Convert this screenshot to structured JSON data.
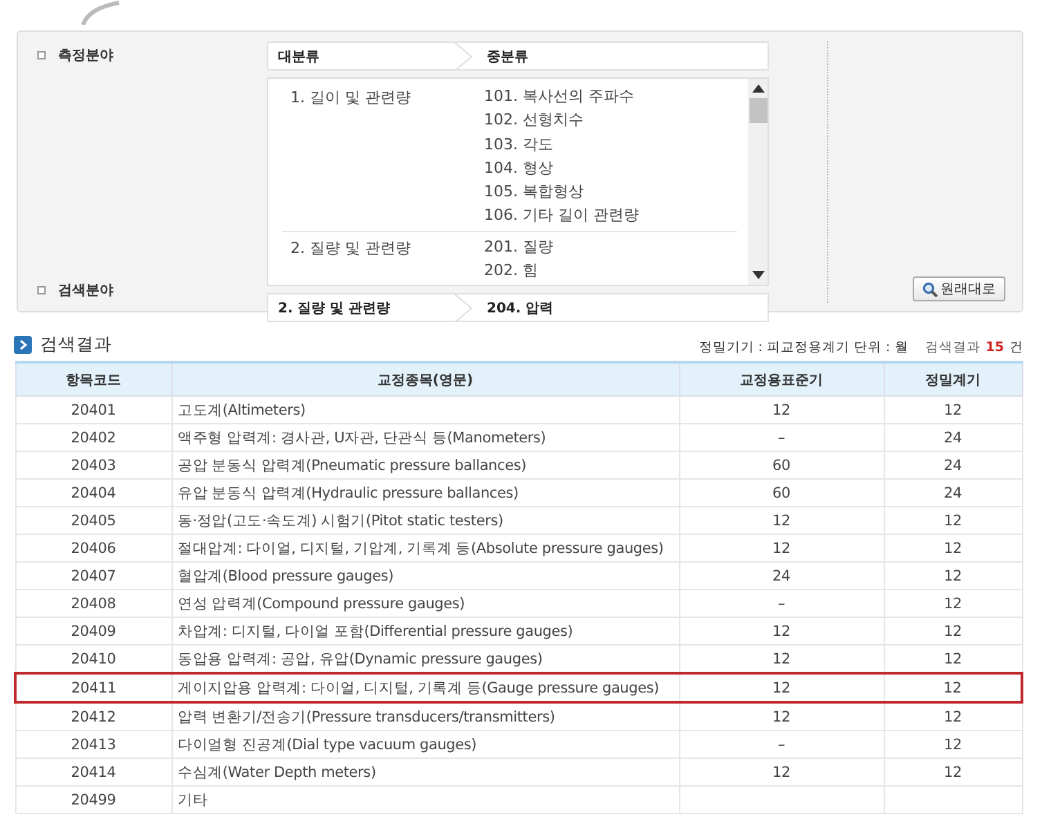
{
  "filter_panel": {
    "field_label": "측정분야",
    "breadcrumb_header": [
      "대분류",
      "중분류"
    ],
    "categories": [
      {
        "label": "1. 길이 및 관련량",
        "children": [
          "101. 복사선의 주파수",
          "102. 선형치수",
          "103. 각도",
          "104. 형상",
          "105. 복합형상",
          "106. 기타 길이 관련량"
        ]
      },
      {
        "label": "2. 질량 및 관련량",
        "children": [
          "201. 질량",
          "202. 힘"
        ]
      }
    ],
    "search_label": "검색분야",
    "search_path": [
      "2. 질량 및 관련량",
      "204. 압력"
    ],
    "reset_button": "원래대로"
  },
  "results": {
    "title": "검색결과",
    "unit_note": "정밀기기 : 피교정용계기 단위 : 월",
    "count_label": "검색결과",
    "count": "15",
    "count_unit": "건",
    "columns": [
      "항목코드",
      "교정종목(영문)",
      "교정용표준기",
      "정밀계기"
    ],
    "rows": [
      {
        "cells": [
          "20401",
          "고도계(Altimeters)",
          "12",
          "12"
        ],
        "selected": false
      },
      {
        "cells": [
          "20402",
          "액주형 압력계: 경사관, U자관, 단관식 등(Manometers)",
          "–",
          "24"
        ],
        "selected": false
      },
      {
        "cells": [
          "20403",
          "공압 분동식 압력계(Pneumatic pressure ballances)",
          "60",
          "24"
        ],
        "selected": false
      },
      {
        "cells": [
          "20404",
          "유압 분동식 압력계(Hydraulic pressure ballances)",
          "60",
          "24"
        ],
        "selected": false
      },
      {
        "cells": [
          "20405",
          "동·정압(고도·속도계) 시험기(Pitot static testers)",
          "12",
          "12"
        ],
        "selected": false
      },
      {
        "cells": [
          "20406",
          "절대압계: 다이얼, 디지털, 기압계, 기록계 등(Absolute pressure gauges)",
          "12",
          "12"
        ],
        "selected": false
      },
      {
        "cells": [
          "20407",
          "혈압계(Blood pressure gauges)",
          "24",
          "12"
        ],
        "selected": false
      },
      {
        "cells": [
          "20408",
          "연성 압력계(Compound pressure gauges)",
          "–",
          "12"
        ],
        "selected": false
      },
      {
        "cells": [
          "20409",
          "차압계: 디지털, 다이얼 포함(Differential pressure gauges)",
          "12",
          "12"
        ],
        "selected": false
      },
      {
        "cells": [
          "20410",
          "동압용 압력계: 공압, 유압(Dynamic pressure gauges)",
          "12",
          "12"
        ],
        "selected": false
      },
      {
        "cells": [
          "20411",
          "게이지압용 압력계: 다이얼, 디지털, 기록계 등(Gauge pressure gauges)",
          "12",
          "12"
        ],
        "selected": true
      },
      {
        "cells": [
          "20412",
          "압력 변환기/전송기(Pressure transducers/transmitters)",
          "12",
          "12"
        ],
        "selected": false
      },
      {
        "cells": [
          "20413",
          "다이얼형 진공계(Dial type vacuum gauges)",
          "–",
          "12"
        ],
        "selected": false
      },
      {
        "cells": [
          "20414",
          "수심계(Water Depth meters)",
          "12",
          "12"
        ],
        "selected": false
      },
      {
        "cells": [
          "20499",
          "기타"
        ],
        "selected": false
      }
    ]
  }
}
